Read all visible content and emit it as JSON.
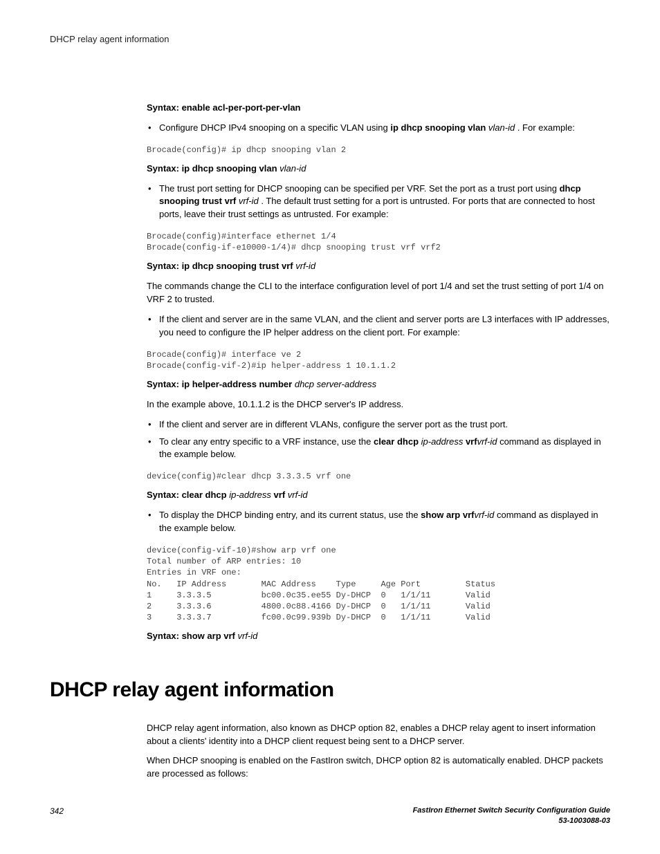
{
  "header": {
    "title": "DHCP relay agent information"
  },
  "syntax1": {
    "label": "Syntax: enable acl-per-port-per-vlan"
  },
  "bullet1": {
    "pre": "Configure DHCP IPv4 snooping on a specific VLAN using ",
    "cmd": "ip dhcp snooping vlan",
    "param": " vlan-id ",
    "post": ". For example:"
  },
  "code1": "Brocade(config)# ip dhcp snooping vlan 2",
  "syntax2": {
    "label": "Syntax: ip dhcp snooping vlan ",
    "param": "vlan-id"
  },
  "bullet2": {
    "pre": "The trust port setting for DHCP snooping can be specified per VRF. Set the port as a trust port using ",
    "cmd": "dhcp snooping trust vrf",
    "param": " vrf-id ",
    "post": ". The default trust setting for a port is untrusted. For ports that are connected to host ports, leave their trust settings as untrusted. For example:"
  },
  "code2": "Brocade(config)#interface ethernet 1/4\nBrocade(config-if-e10000-1/4)# dhcp snooping trust vrf vrf2",
  "syntax3": {
    "label": "Syntax: ip dhcp snooping trust vrf ",
    "param": "vrf-id"
  },
  "para1": "The commands change the CLI to the interface configuration level of port 1/4 and set the trust setting of port 1/4 on VRF 2 to trusted.",
  "bullet3": "If the client and server are in the same VLAN, and the client and server ports are L3 interfaces with IP addresses, you need to configure the IP helper address on the client port. For example:",
  "code3": "Brocade(config)# interface ve 2\nBrocade(config-vif-2)#ip helper-address 1 10.1.1.2",
  "syntax4": {
    "label": "Syntax: ip helper-address number ",
    "param": "dhcp server-address"
  },
  "para2": "In the example above, 10.1.1.2 is the DHCP server's IP address.",
  "bullet4": "If the client and server are in different VLANs, configure the server port as the trust port.",
  "bullet5": {
    "pre": "To clear any entry specific to a VRF instance, use the ",
    "cmd1": "clear dhcp ",
    "param1": "ip-address ",
    "cmd2": "vrf",
    "param2": "vrf-id",
    "post": " command as displayed in the example below."
  },
  "code4": "device(config)#clear dhcp 3.3.3.5 vrf one",
  "syntax5": {
    "label1": "Syntax: clear dhcp ",
    "param1": "ip-address",
    "label2": " vrf ",
    "param2": "vrf-id"
  },
  "bullet6": {
    "pre": "To display the DHCP binding entry, and its current status, use the ",
    "cmd": "show arp vrf",
    "param": "vrf-id",
    "post": " command as displayed in the example below."
  },
  "code5": "device(config-vif-10)#show arp vrf one\nTotal number of ARP entries: 10\nEntries in VRF one:\nNo.   IP Address       MAC Address    Type     Age Port         Status\n1     3.3.3.5          bc00.0c35.ee55 Dy-DHCP  0   1/1/11       Valid\n2     3.3.3.6          4800.0c88.4166 Dy-DHCP  0   1/1/11       Valid\n3     3.3.3.7          fc00.0c99.939b Dy-DHCP  0   1/1/11       Valid",
  "syntax6": {
    "label": "Syntax: show arp vrf ",
    "param": "vrf-id"
  },
  "section": {
    "title": "DHCP relay agent information"
  },
  "para3": "DHCP relay agent information, also known as DHCP option 82, enables a DHCP relay agent to insert information about a clients' identity into a DHCP client request being sent to a DHCP server.",
  "para4": "When DHCP snooping is enabled on the FastIron switch, DHCP option 82 is automatically enabled. DHCP packets are processed as follows:",
  "footer": {
    "page": "342",
    "doc1": "FastIron Ethernet Switch Security Configuration Guide",
    "doc2": "53-1003088-03"
  },
  "chart_data": {
    "type": "table",
    "title": "ARP entries in VRF one",
    "columns": [
      "No.",
      "IP Address",
      "MAC Address",
      "Type",
      "Age",
      "Port",
      "Status"
    ],
    "rows": [
      [
        "1",
        "3.3.3.5",
        "bc00.0c35.ee55",
        "Dy-DHCP",
        "0",
        "1/1/11",
        "Valid"
      ],
      [
        "2",
        "3.3.3.6",
        "4800.0c88.4166",
        "Dy-DHCP",
        "0",
        "1/1/11",
        "Valid"
      ],
      [
        "3",
        "3.3.3.7",
        "fc00.0c99.939b",
        "Dy-DHCP",
        "0",
        "1/1/11",
        "Valid"
      ]
    ],
    "total_entries": 10
  }
}
